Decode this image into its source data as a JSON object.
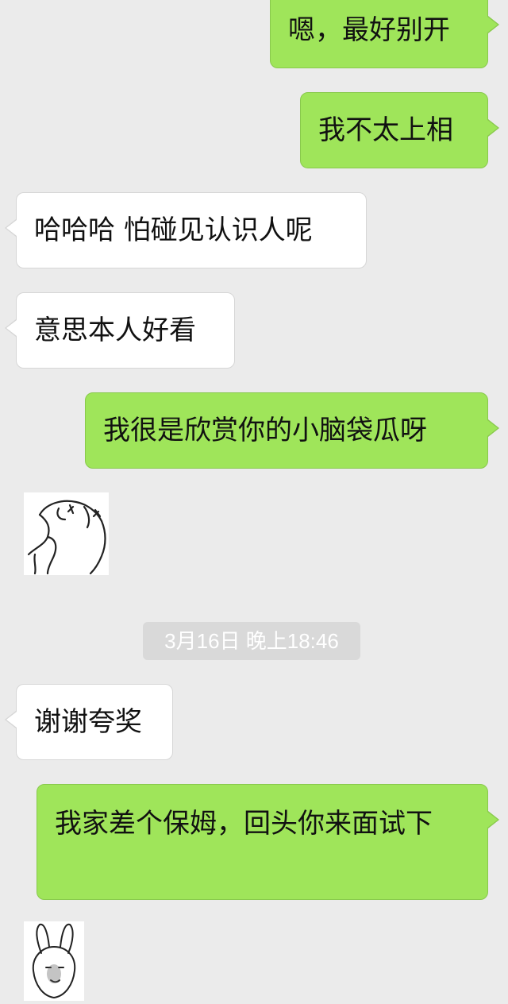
{
  "chat": {
    "messages": [
      {
        "side": "sent",
        "text": "嗯，最好别开"
      },
      {
        "side": "sent",
        "text": "我不太上相"
      },
      {
        "side": "received",
        "text": "哈哈哈 怕碰见认识人呢"
      },
      {
        "side": "received",
        "text": "意思本人好看"
      },
      {
        "side": "sent",
        "text": "我很是欣赏你的小脑袋瓜呀"
      },
      {
        "side": "received",
        "sticker": "hand-drawn-figure-sticker"
      },
      {
        "side": "received",
        "text": "谢谢夸奖"
      },
      {
        "side": "sent",
        "text": "我家差个保姆，回头你来面试下"
      },
      {
        "side": "received",
        "sticker": "bunny-head-sticker"
      }
    ],
    "timestamp": "3月16日 晚上18:46"
  },
  "colors": {
    "background": "#ebebeb",
    "sent_bubble": "#9fe55a",
    "received_bubble": "#ffffff",
    "timestamp_bg": "#d9d9d9"
  }
}
